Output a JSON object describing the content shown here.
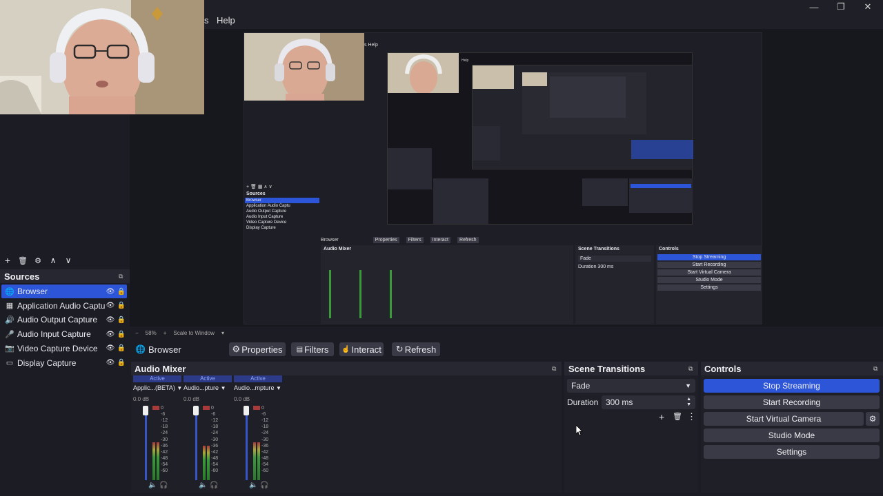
{
  "window": {
    "minimize_glyph": "—",
    "maximize_glyph": "❐",
    "close_glyph": "✕"
  },
  "menu": {
    "partial": "s",
    "help": "Help"
  },
  "preview_inner": {
    "help": "Help",
    "partial": "s",
    "help2": "Help",
    "sources_title": "Sources",
    "sources": [
      "Browser",
      "Application Audio Captu",
      "Audio Output Capture",
      "Audio Input Capture",
      "Video Capture Device",
      "Display Capture"
    ],
    "context_label": "Browser",
    "properties": "Properties",
    "filters": "Filters",
    "interact": "Interact",
    "refresh": "Refresh",
    "audio_mixer": "Audio Mixer",
    "scene_transitions": "Scene Transitions",
    "controls": "Controls",
    "fade": "Fade",
    "duration_label": "Duration",
    "duration_value": "300 ms",
    "stop_streaming": "Stop Streaming",
    "start_recording": "Start Recording",
    "start_virtual_camera": "Start Virtual Camera",
    "studio_mode": "Studio Mode",
    "settings": "Settings",
    "zoom": "58%",
    "scale": "Scale to Window"
  },
  "zoom_bar": {
    "minus": "−",
    "zoom": "58%",
    "plus": "+",
    "scale": "Scale to Window"
  },
  "sources_panel": {
    "title": "Sources",
    "toolbar": [
      "+",
      "🗑",
      "⚙",
      "∧",
      "∨"
    ],
    "items": [
      {
        "icon": "globe-icon",
        "glyph": "🌐",
        "label": "Browser",
        "selected": true
      },
      {
        "icon": "app-audio-icon",
        "glyph": "▦",
        "label": "Application Audio Captu",
        "selected": false
      },
      {
        "icon": "speaker-icon",
        "glyph": "🔊",
        "label": "Audio Output Capture",
        "selected": false
      },
      {
        "icon": "microphone-icon",
        "glyph": "🎤",
        "label": "Audio Input Capture",
        "selected": false
      },
      {
        "icon": "camera-icon",
        "glyph": "📷",
        "label": "Video Capture Device",
        "selected": false
      },
      {
        "icon": "monitor-icon",
        "glyph": "▭",
        "label": "Display Capture",
        "selected": false
      }
    ]
  },
  "context_bar": {
    "source": "Browser",
    "properties": "Properties",
    "filters": "Filters",
    "interact": "Interact",
    "refresh": "Refresh"
  },
  "audio_mixer": {
    "title": "Audio Mixer",
    "channels": [
      {
        "status": "Active",
        "name": "Applic...(BETA)",
        "db": "0.0 dB",
        "level": 0.55
      },
      {
        "status": "Active",
        "name": "Audio...pture",
        "db": "0.0 dB",
        "level": 0.5
      },
      {
        "status": "Active",
        "name": "Audio...mpture",
        "db": "0.0 dB",
        "level": 0.55
      }
    ],
    "scale": [
      "0",
      "-6",
      "-12",
      "-18",
      "-24",
      "-30",
      "-36",
      "-42",
      "-48",
      "-54",
      "-60"
    ]
  },
  "scene_transitions": {
    "title": "Scene Transitions",
    "transition": "Fade",
    "duration_label": "Duration",
    "duration_value": "300 ms"
  },
  "controls": {
    "title": "Controls",
    "stop_streaming": "Stop Streaming",
    "start_recording": "Start Recording",
    "start_virtual_camera": "Start Virtual Camera",
    "studio_mode": "Studio Mode",
    "settings": "Settings"
  },
  "colors": {
    "accent": "#2d55d8",
    "background": "#1c1c24",
    "dock": "#272731"
  }
}
